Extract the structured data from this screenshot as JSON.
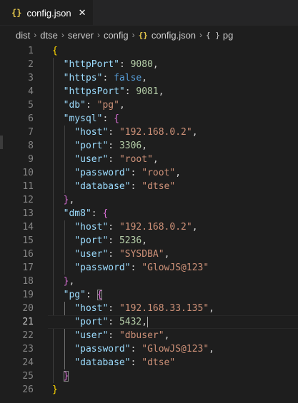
{
  "tab": {
    "label": "config.json",
    "icon": "{}",
    "close": "✕"
  },
  "breadcrumb": {
    "items": [
      "dist",
      "dtse",
      "server",
      "config",
      "config.json",
      "pg"
    ],
    "json_icon": "{}",
    "object_icon": "{ }"
  },
  "editor": {
    "current_line": 21,
    "lines": [
      {
        "num": "1"
      },
      {
        "num": "2"
      },
      {
        "num": "3"
      },
      {
        "num": "4"
      },
      {
        "num": "5"
      },
      {
        "num": "6"
      },
      {
        "num": "7"
      },
      {
        "num": "8"
      },
      {
        "num": "9"
      },
      {
        "num": "10"
      },
      {
        "num": "11"
      },
      {
        "num": "12"
      },
      {
        "num": "13"
      },
      {
        "num": "14"
      },
      {
        "num": "15"
      },
      {
        "num": "16"
      },
      {
        "num": "17"
      },
      {
        "num": "18"
      },
      {
        "num": "19"
      },
      {
        "num": "20"
      },
      {
        "num": "21"
      },
      {
        "num": "22"
      },
      {
        "num": "23"
      },
      {
        "num": "24"
      },
      {
        "num": "25"
      },
      {
        "num": "26"
      }
    ],
    "tokens": {
      "brace_open": "{",
      "brace_close": "}",
      "brace_close_comma": "},",
      "httpPort_key": "\"httpPort\"",
      "httpPort_val": "9080",
      "https_key": "\"https\"",
      "https_val": "false",
      "httpsPort_key": "\"httpsPort\"",
      "httpsPort_val": "9081",
      "db_key": "\"db\"",
      "db_val": "\"pg\"",
      "mysql_key": "\"mysql\"",
      "mysql_host_key": "\"host\"",
      "mysql_host_val": "\"192.168.0.2\"",
      "mysql_port_key": "\"port\"",
      "mysql_port_val": "3306",
      "mysql_user_key": "\"user\"",
      "mysql_user_val": "\"root\"",
      "mysql_password_key": "\"password\"",
      "mysql_password_val": "\"root\"",
      "mysql_database_key": "\"database\"",
      "mysql_database_val": "\"dtse\"",
      "dm8_key": "\"dm8\"",
      "dm8_host_key": "\"host\"",
      "dm8_host_val": "\"192.168.0.2\"",
      "dm8_port_key": "\"port\"",
      "dm8_port_val": "5236",
      "dm8_user_key": "\"user\"",
      "dm8_user_val": "\"SYSDBA\"",
      "dm8_password_key": "\"password\"",
      "dm8_password_val": "\"GlowJS@123\"",
      "pg_key": "\"pg\"",
      "pg_host_key": "\"host\"",
      "pg_host_val": "\"192.168.33.135\"",
      "pg_port_key": "\"port\"",
      "pg_port_val": "5432",
      "pg_user_key": "\"user\"",
      "pg_user_val": "\"dbuser\"",
      "pg_password_key": "\"password\"",
      "pg_password_val": "\"GlowJS@123\"",
      "pg_database_key": "\"database\"",
      "pg_database_val": "\"dtse\""
    }
  },
  "colors": {
    "background": "#1e1e1e",
    "key": "#9cdcfe",
    "string": "#ce9178",
    "number": "#b5cea8",
    "boolean": "#569cd6",
    "bracket_level1": "#ffd700",
    "bracket_level2": "#da70d6",
    "json_icon": "#e6c84c"
  }
}
